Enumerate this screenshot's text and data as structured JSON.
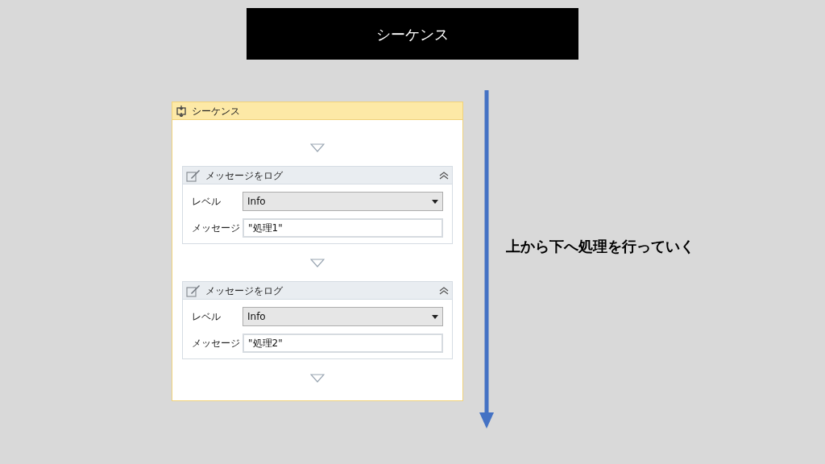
{
  "slide_title": "シーケンス",
  "sequence": {
    "title": "シーケンス",
    "activities": [
      {
        "title": "メッセージをログ",
        "fields": [
          {
            "kind": "dropdown",
            "label": "レベル",
            "value": "Info"
          },
          {
            "kind": "text",
            "label": "メッセージ",
            "value": "\"処理1\""
          }
        ]
      },
      {
        "title": "メッセージをログ",
        "fields": [
          {
            "kind": "dropdown",
            "label": "レベル",
            "value": "Info"
          },
          {
            "kind": "text",
            "label": "メッセージ",
            "value": "\"処理2\""
          }
        ]
      }
    ]
  },
  "caption": "上から下へ処理を行っていく"
}
